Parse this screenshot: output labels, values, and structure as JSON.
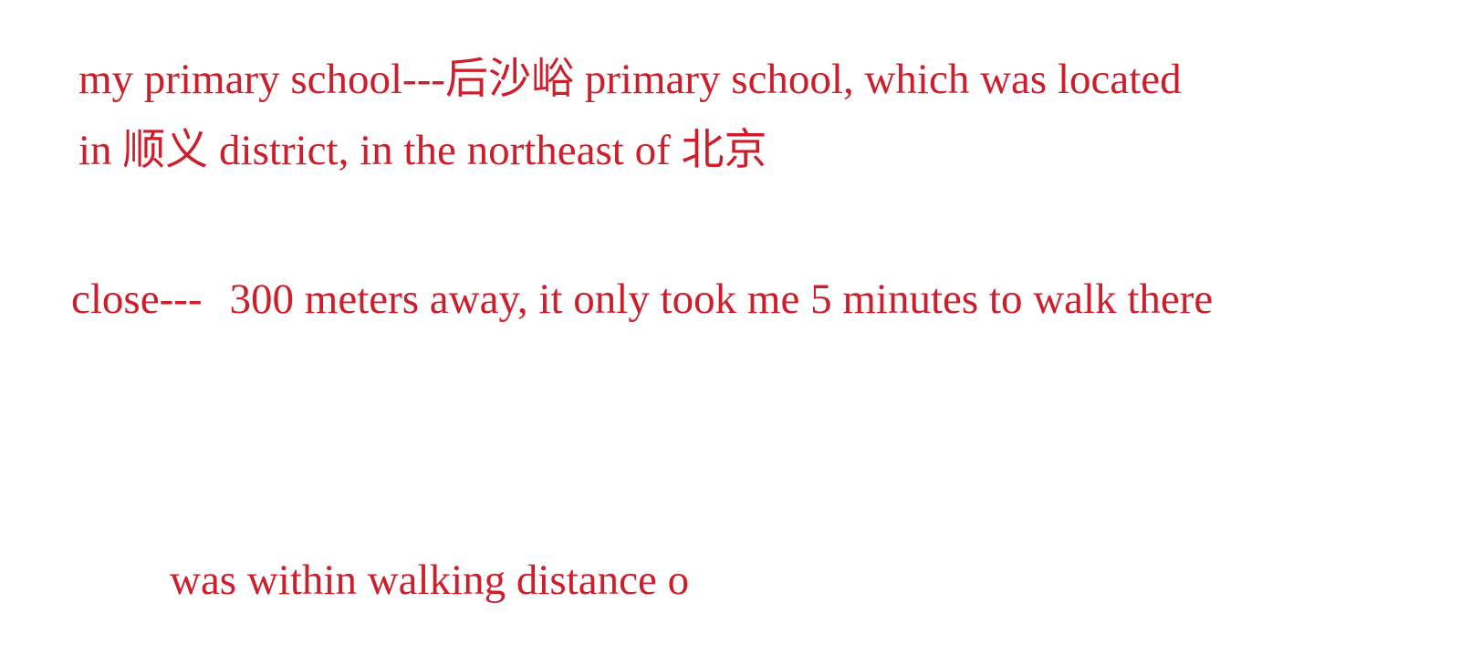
{
  "colors": {
    "text": "#cc1f2b",
    "background": "#ffffff"
  },
  "notes": {
    "line1": "my primary school---后沙峪 primary school, which was located",
    "line2": "in 顺义 district, in the northeast of 北京",
    "line3_label": "close---",
    "line3_text": "300 meters away, it only took me 5 minutes to walk there",
    "line4": "was within walking distance o"
  }
}
